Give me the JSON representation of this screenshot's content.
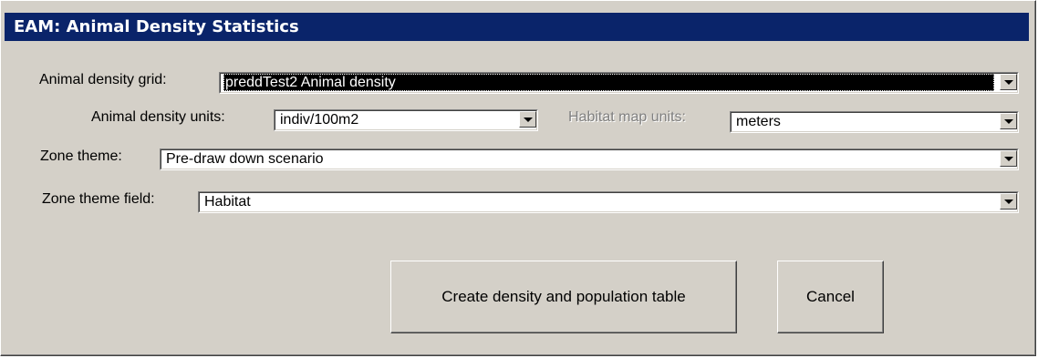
{
  "window": {
    "title": "EAM: Animal Density Statistics"
  },
  "form": {
    "density_grid": {
      "label": "Animal density grid:",
      "value": "preddTest2 Animal density"
    },
    "density_units": {
      "label": "Animal density units:",
      "value": "indiv/100m2"
    },
    "habitat_units": {
      "label": "Habitat map units:",
      "value": "meters"
    },
    "zone_theme": {
      "label": "Zone theme:",
      "value": "Pre-draw down scenario"
    },
    "zone_field": {
      "label": "Zone theme field:",
      "value": "Habitat"
    }
  },
  "buttons": {
    "create_label": "Create density and population table",
    "cancel_label": "Cancel"
  },
  "icons": {
    "dropdown": "chevron-down-icon"
  },
  "colors": {
    "titlebar": "#0a246a",
    "face": "#d4d0c8"
  }
}
